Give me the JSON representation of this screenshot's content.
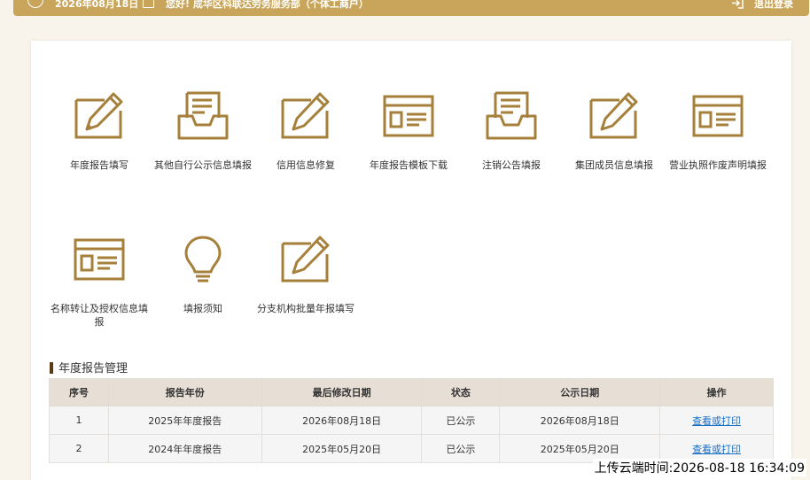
{
  "topbar": {
    "date": "2026年08月18日",
    "greeting": "您好! 成华区科联达劳务服务部（个体工商户）",
    "logout": "退出登录"
  },
  "colors": {
    "accent": "#c8a55b",
    "icon": "#a6803a",
    "link": "#1a6fc4"
  },
  "tiles": [
    {
      "label": "年度报告填写",
      "icon": "pen-icon"
    },
    {
      "label": "其他自行公示信息填报",
      "icon": "inbox-icon"
    },
    {
      "label": "信用信息修复",
      "icon": "pen-icon"
    },
    {
      "label": "年度报告模板下载",
      "icon": "form-icon"
    },
    {
      "label": "注销公告填报",
      "icon": "inbox-icon"
    },
    {
      "label": "集团成员信息填报",
      "icon": "pen-icon"
    },
    {
      "label": "营业执照作废声明填报",
      "icon": "form-icon"
    },
    {
      "label": "名称转让及授权信息填报",
      "icon": "form-icon"
    },
    {
      "label": "填报须知",
      "icon": "bulb-icon"
    },
    {
      "label": "分支机构批量年报填写",
      "icon": "pen-icon"
    }
  ],
  "section": {
    "title": "年度报告管理"
  },
  "table": {
    "headers": [
      "序号",
      "报告年份",
      "最后修改日期",
      "状态",
      "公示日期",
      "操作"
    ],
    "rows": [
      [
        "1",
        "2025年年度报告",
        "2026年08月18日",
        "已公示",
        "2026年08月18日",
        "查看或打印"
      ],
      [
        "2",
        "2024年年度报告",
        "2025年05月20日",
        "已公示",
        "2025年05月20日",
        "查看或打印"
      ]
    ]
  },
  "upload_stamp": "上传云端时间:2026-08-18 16:34:09"
}
